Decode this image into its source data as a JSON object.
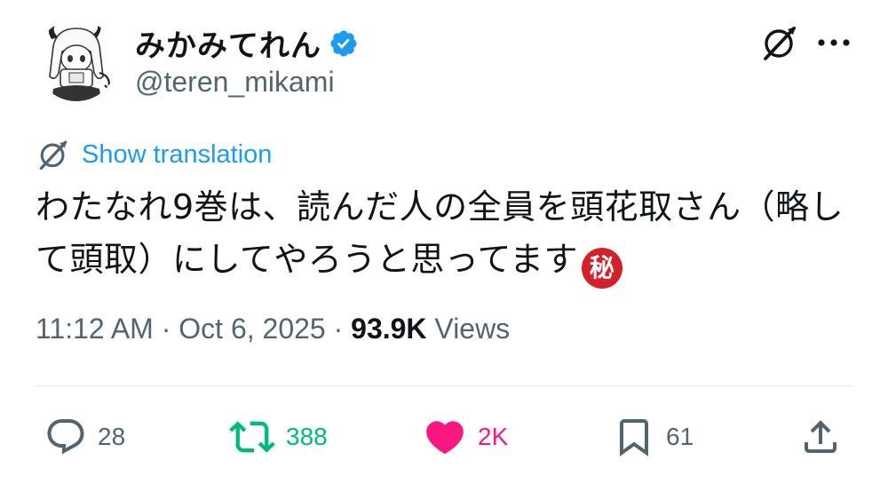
{
  "user": {
    "display_name": "みかみてれん",
    "handle": "@teren_mikami",
    "verified": true
  },
  "header_icons": [
    "grok-icon",
    "more-icon"
  ],
  "translation": {
    "label": "Show translation"
  },
  "tweet": {
    "text": "わたなれ9巻は、読んだ人の全員を頭花取さん（略して頭取）にしてやろうと思ってます",
    "emoji": "秘"
  },
  "meta": {
    "time": "11:12 AM",
    "date": "Oct 6, 2025",
    "separator": "·",
    "views_count": "93.9K",
    "views_label": "Views"
  },
  "actions": {
    "replies": "28",
    "reposts": "388",
    "likes": "2K",
    "bookmarks": "61"
  },
  "colors": {
    "accent": "#1d9bf0",
    "repost": "#00ba7c",
    "like": "#f91880",
    "muted": "#536471",
    "secret_emoji": "#d3202b"
  }
}
